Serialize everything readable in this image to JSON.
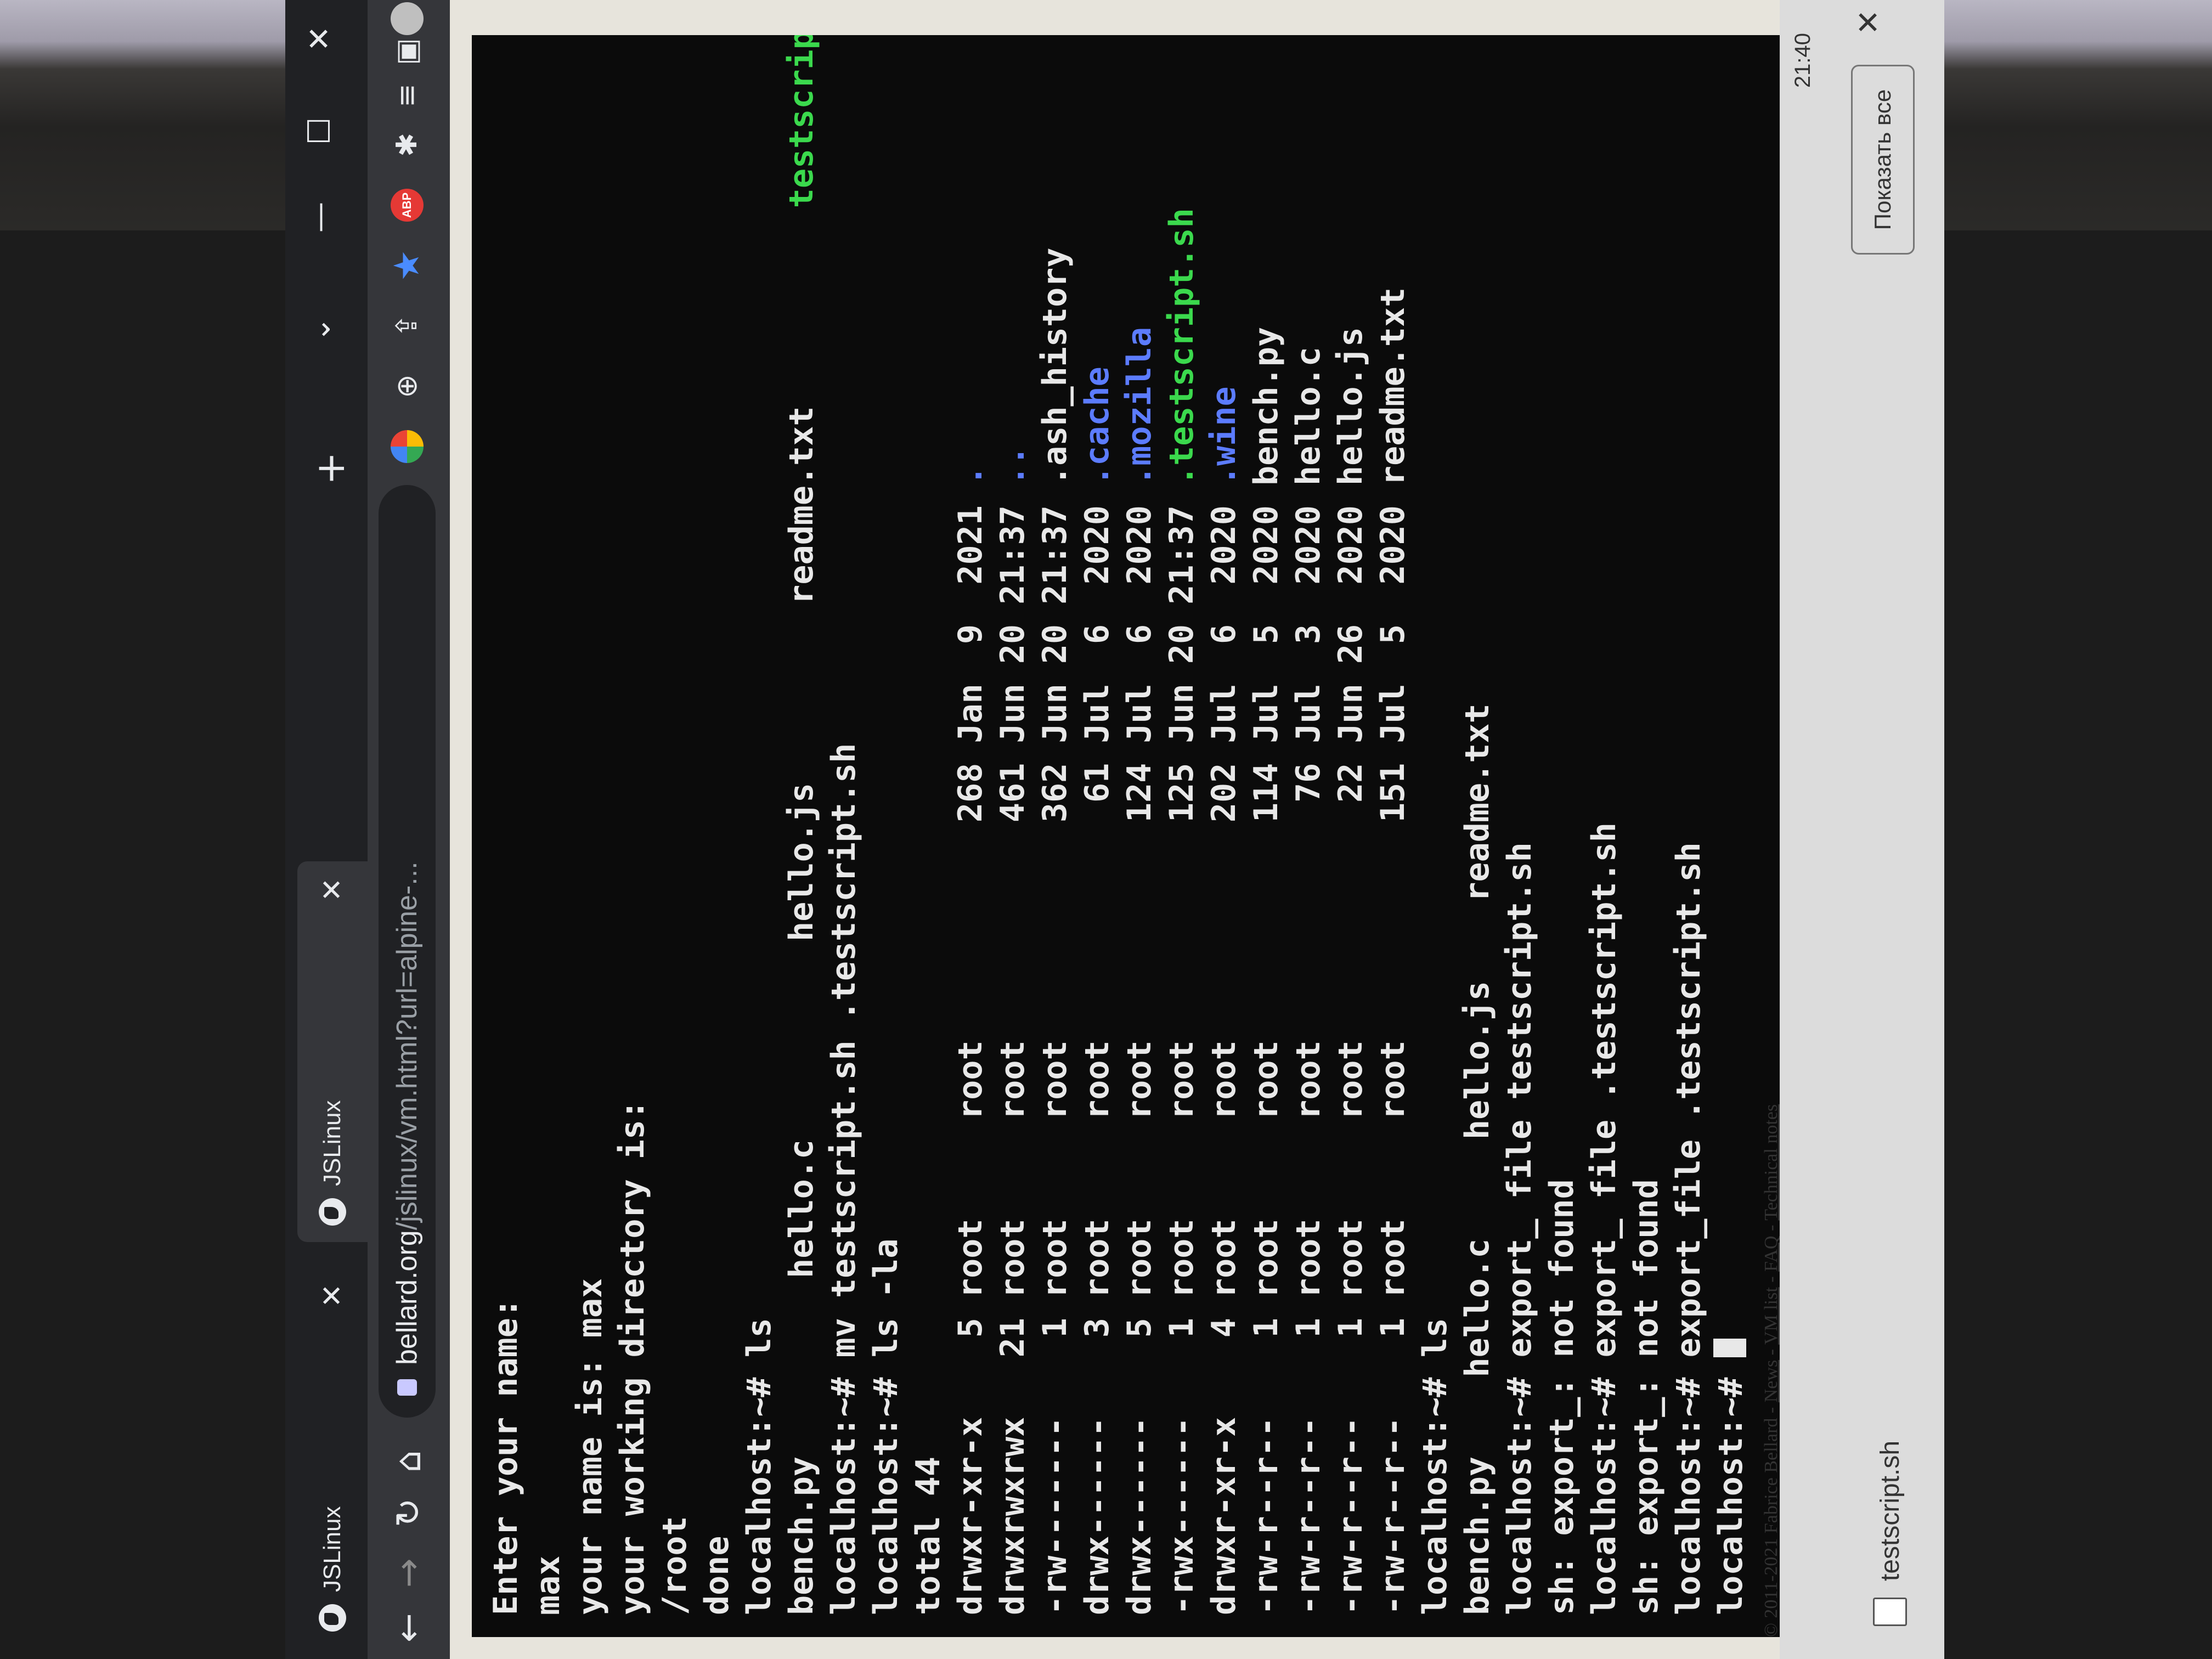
{
  "browser": {
    "tabs": [
      {
        "title": "JSLinux",
        "active": false
      },
      {
        "title": "JSLinux",
        "active": true
      }
    ],
    "url_host": "bellard.org",
    "url_path": "/jslinux/vm.html?url=alpine-...",
    "icons": [
      "back-icon",
      "forward-icon",
      "reload-icon",
      "home-icon",
      "lock-icon",
      "google-icon",
      "zoom-icon",
      "share-icon",
      "bookmark-star-icon",
      "adblock-icon",
      "extensions-icon",
      "media-icon",
      "sidepanel-icon",
      "avatar-icon",
      "menu-icon"
    ]
  },
  "terminal": {
    "lines": [
      {
        "t": "Enter your name:"
      },
      {
        "t": "max"
      },
      {
        "t": "your name is: max"
      },
      {
        "t": "your working directory is:"
      },
      {
        "t": "/root"
      },
      {
        "t": "done"
      },
      {
        "t": "localhost:~# ls"
      },
      {
        "segs": [
          [
            "bench.py         hello.c          hello.js         readme.txt          ",
            ""
          ],
          [
            "testscript.sh",
            "exe"
          ]
        ]
      },
      {
        "t": "localhost:~# mv testscript.sh .testscript.sh"
      },
      {
        "t": "localhost:~# ls -la"
      },
      {
        "t": "total 44"
      },
      {
        "segs": [
          [
            "drwxr-xr-x    5 root     root           268 Jan  9  2021 ",
            ""
          ],
          [
            ".",
            "dir"
          ]
        ]
      },
      {
        "segs": [
          [
            "drwxrwxrwx   21 root     root           461 Jun 20 21:37 ",
            ""
          ],
          [
            "..",
            "dir"
          ]
        ]
      },
      {
        "t": "-rw-------    1 root     root           362 Jun 20 21:37 .ash_history"
      },
      {
        "segs": [
          [
            "drwx------    3 root     root            61 Jul  6  2020 ",
            ""
          ],
          [
            ".cache",
            "dir"
          ]
        ]
      },
      {
        "segs": [
          [
            "drwx------    5 root     root           124 Jul  6  2020 ",
            ""
          ],
          [
            ".mozilla",
            "dir"
          ]
        ]
      },
      {
        "segs": [
          [
            "-rwx------    1 root     root           125 Jun 20 21:37 ",
            ""
          ],
          [
            ".testscript.sh",
            "exe"
          ]
        ]
      },
      {
        "segs": [
          [
            "drwxr-xr-x    4 root     root           202 Jul  6  2020 ",
            ""
          ],
          [
            ".wine",
            "dir"
          ]
        ]
      },
      {
        "t": "-rw-r--r--    1 root     root           114 Jul  5  2020 bench.py"
      },
      {
        "t": "-rw-r--r--    1 root     root            76 Jul  3  2020 hello.c"
      },
      {
        "t": "-rw-r--r--    1 root     root            22 Jun 26  2020 hello.js"
      },
      {
        "t": "-rw-r--r--    1 root     root           151 Jul  5  2020 readme.txt"
      },
      {
        "t": "localhost:~# ls"
      },
      {
        "t": "bench.py    hello.c     hello.js    readme.txt"
      },
      {
        "t": "localhost:~# export_ file testscript.sh"
      },
      {
        "t": "sh: export_: not found"
      },
      {
        "t": "localhost:~# export_ file .testscript.sh"
      },
      {
        "t": "sh: export_: not found"
      },
      {
        "t": "localhost:~# export_file .testscript.sh"
      },
      {
        "t": "localhost:~# "
      }
    ]
  },
  "footer": {
    "copyright": "© 2011-2021 Fabrice Bellard - ",
    "links": [
      "News",
      "VM list",
      "FAQ",
      "Technical notes"
    ]
  },
  "downloads": {
    "file": "testscript.sh",
    "show_all": "Показать все"
  },
  "taskbar": {
    "time": "21:40"
  }
}
